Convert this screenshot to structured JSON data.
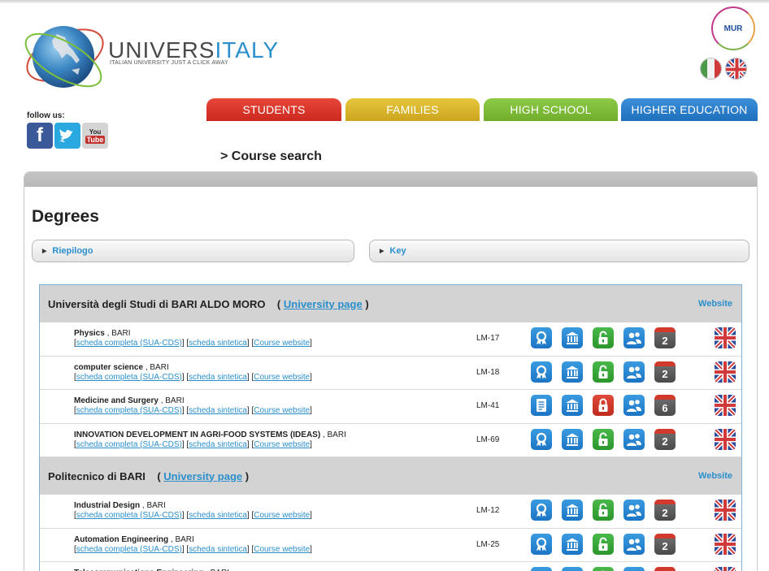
{
  "brand": {
    "title_part1": "UNIVERS",
    "title_part2": "ITALY",
    "tagline": "ITALIAN UNIVERSITY JUST A CLICK AWAY",
    "mur_label": "MUR"
  },
  "social": {
    "follow_label": "follow us:",
    "facebook": "f",
    "twitter": "t",
    "youtube_top": "You",
    "youtube_bottom": "Tube"
  },
  "nav": {
    "students": "STUDENTS",
    "families": "FAMILIES",
    "high_school": "HIGH SCHOOL",
    "higher_education": "HIGHER EDUCATION"
  },
  "breadcrumb": "> Course search",
  "page_title": "Degrees",
  "accordions": {
    "riepilogo": "Riepilogo",
    "key": "Key"
  },
  "links": {
    "full": "scheda completa (SUA-CDS)",
    "short": "scheda sintetica",
    "site": "Course website"
  },
  "universities": [
    {
      "name": "Università degli Studi di BARI ALDO MORO",
      "page_link": "University page",
      "website": "Website",
      "courses": [
        {
          "name": "Physics",
          "city": "BARI",
          "code": "LM-17",
          "first_icon": "award",
          "access": "open",
          "years": "2"
        },
        {
          "name": "computer science",
          "city": "BARI",
          "code": "LM-18",
          "first_icon": "award",
          "access": "open",
          "years": "2"
        },
        {
          "name": "Medicine and Surgery",
          "city": "BARI",
          "code": "LM-41",
          "first_icon": "document",
          "access": "restricted",
          "years": "6"
        },
        {
          "name": "INNOVATION DEVELOPMENT IN AGRI-FOOD SYSTEMS (IDEAS)",
          "city": "BARI",
          "code": "LM-69",
          "first_icon": "award",
          "access": "open",
          "years": "2"
        }
      ]
    },
    {
      "name": "Politecnico di BARI",
      "page_link": "University page",
      "website": "Website",
      "courses": [
        {
          "name": "Industrial Design",
          "city": "BARI",
          "code": "LM-12",
          "first_icon": "award",
          "access": "open",
          "years": "2"
        },
        {
          "name": "Automation Engineering",
          "city": "BARI",
          "code": "LM-25",
          "first_icon": "award",
          "access": "open",
          "years": "2"
        },
        {
          "name": "Telecommunications Engineering",
          "city": "BARI",
          "code": "",
          "first_icon": "award",
          "access": "open",
          "years": ""
        }
      ]
    }
  ],
  "colors": {
    "accent_blue": "#2a8fcc",
    "students_tab": "#d9362a",
    "families_tab": "#dab62c",
    "highschool_tab": "#7dbc38",
    "higher_tab": "#2a7fcb"
  }
}
